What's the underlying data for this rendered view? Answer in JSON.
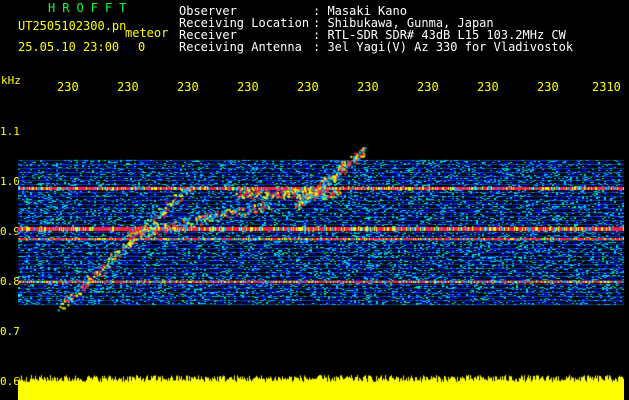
{
  "header": {
    "title": "HROFFT",
    "file_name": "UT2505102300.pn",
    "event_type": "meteor",
    "date_time": "25.05.10 23:00",
    "count": "0"
  },
  "info": [
    {
      "label": "Observer",
      "value": ": Masaki Kano"
    },
    {
      "label": "Receiving Location",
      "value": ": Shibukawa, Gunma, Japan"
    },
    {
      "label": "Receiver",
      "value": ": RTL-SDR SDR# 43dB L15 103.2MHz CW"
    },
    {
      "label": "Receiving Antenna",
      "value": ": 3el Yagi(V) Az 330 for Vladivostok"
    }
  ],
  "axis": {
    "unit": "kHz",
    "x_ticks": [
      "230",
      "230",
      "230",
      "230",
      "230",
      "230",
      "230",
      "230",
      "230",
      "2310"
    ],
    "y_ticks": [
      "1.1",
      "1.0",
      "0.9",
      "0.8",
      "0.7",
      "0.6"
    ]
  },
  "colors": {
    "background": "#000000",
    "header_text": "#ffffff",
    "title_text": "#00ff40",
    "axis_text": "#ffff00",
    "noise_low": "#0000c8",
    "noise_mid": "#00c8ff",
    "noise_high": "#ffff00",
    "signal": "#ff2040",
    "bottom_band": "#ffff00"
  }
}
